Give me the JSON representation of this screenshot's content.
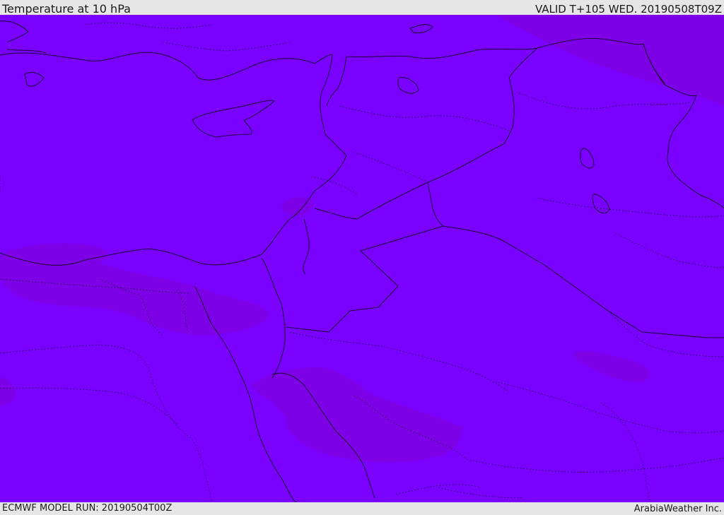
{
  "header": {
    "title": "Temperature at 10 hPa",
    "valid": "VALID T+105 WED. 20190508T09Z"
  },
  "footer": {
    "model_run": "ECMWF MODEL RUN: 20190504T00Z",
    "credit": "ArabiaWeather Inc."
  },
  "colors": {
    "field_base": "#7a00ff",
    "field_cooler": "#7d00e4",
    "coastline": "#1a0033",
    "border_dotted": "#2a0060",
    "header_bg": "#e6e6e6"
  }
}
